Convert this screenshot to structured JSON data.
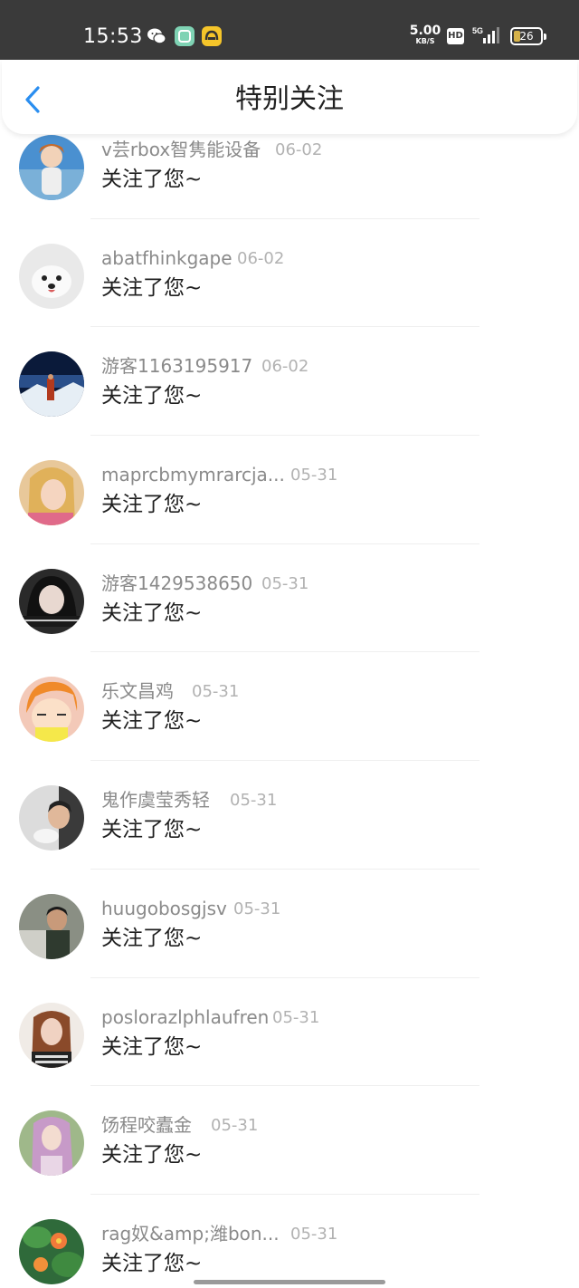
{
  "status_bar": {
    "time": "15:53",
    "net_speed_value": "5.00",
    "net_speed_unit": "KB/S",
    "hd_label": "HD",
    "network_label": "5G",
    "battery_level": "26",
    "icons": [
      "wechat-icon",
      "app-green-icon",
      "app-yellow-icon",
      "signal-icon",
      "battery-icon"
    ]
  },
  "header": {
    "title": "特别关注",
    "back_icon": "chevron-left-icon",
    "accent_color": "#2a8ef0"
  },
  "notifications": [
    {
      "username": "v芸rbox智隽能设备",
      "date": "06-02",
      "message": "关注了您~"
    },
    {
      "username": "abatfhinkgape",
      "date": "06-02",
      "message": "关注了您~"
    },
    {
      "username": "游客1163195917",
      "date": "06-02",
      "message": "关注了您~"
    },
    {
      "username": "maprcbmymrarcja...",
      "date": "05-31",
      "message": "关注了您~"
    },
    {
      "username": "游客1429538650",
      "date": "05-31",
      "message": "关注了您~"
    },
    {
      "username": "乐文昌鸡",
      "date": "05-31",
      "message": "关注了您~"
    },
    {
      "username": "鬼作虞莹秀轻",
      "date": "05-31",
      "message": "关注了您~"
    },
    {
      "username": "huugobosgjsv",
      "date": "05-31",
      "message": "关注了您~"
    },
    {
      "username": "poslorazlphlaufren",
      "date": "05-31",
      "message": "关注了您~"
    },
    {
      "username": "饧程咬蠹金",
      "date": "05-31",
      "message": "关注了您~"
    },
    {
      "username": "rag奴&amp;潍bon...",
      "date": "05-31",
      "message": "关注了您~"
    }
  ]
}
